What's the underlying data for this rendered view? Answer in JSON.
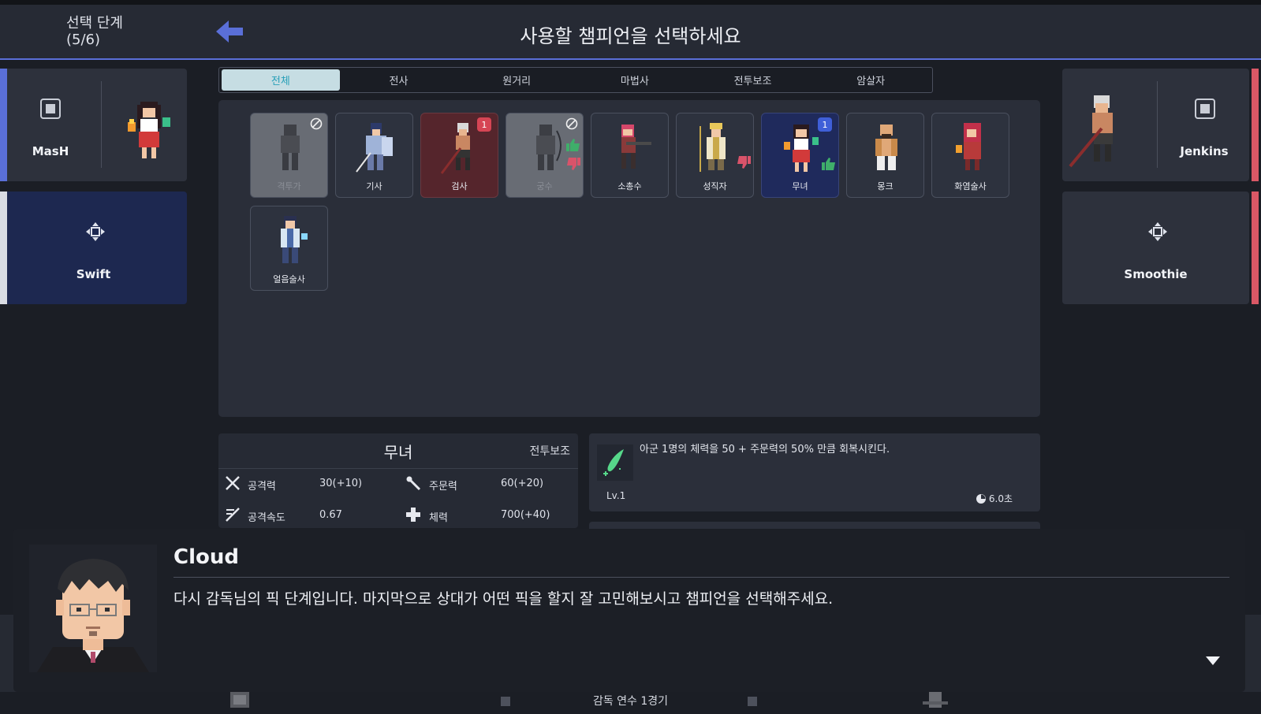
{
  "header": {
    "phase_label": "선택 단계",
    "phase_progress": "(5/6)",
    "title": "사용할 챔피언을 선택하세요"
  },
  "left_team": [
    {
      "player": "MasH",
      "champion_icon": "shrine-maiden-sprite",
      "status": "picked",
      "bar_color": "#5a6fd8"
    },
    {
      "player": "Swift",
      "status": "picking",
      "bar_color": "#d9dce3"
    }
  ],
  "right_team": [
    {
      "player": "Jenkins",
      "champion_icon": "swordsman-sprite",
      "status": "picked",
      "bar_color": "#d95866"
    },
    {
      "player": "Smoothie",
      "status": "waiting",
      "bar_color": "#d95866"
    }
  ],
  "tabs": [
    {
      "label": "전체",
      "active": true
    },
    {
      "label": "전사",
      "active": false
    },
    {
      "label": "원거리",
      "active": false
    },
    {
      "label": "마법사",
      "active": false
    },
    {
      "label": "전투보조",
      "active": false
    },
    {
      "label": "암살자",
      "active": false
    }
  ],
  "champions": [
    {
      "name": "격투가",
      "state": "banned"
    },
    {
      "name": "기사",
      "state": "available"
    },
    {
      "name": "검사",
      "state": "enemy-picked",
      "badge": "1"
    },
    {
      "name": "궁수",
      "state": "banned",
      "votes": "up-down"
    },
    {
      "name": "소총수",
      "state": "available"
    },
    {
      "name": "성직자",
      "state": "available",
      "votes": "down"
    },
    {
      "name": "무녀",
      "state": "ally-selected",
      "badge": "1",
      "votes": "up"
    },
    {
      "name": "몽크",
      "state": "available"
    },
    {
      "name": "화염술사",
      "state": "available"
    },
    {
      "name": "얼음술사",
      "state": "available"
    }
  ],
  "info": {
    "name": "무녀",
    "class": "전투보조",
    "stats": [
      {
        "label": "공격력",
        "value": "30(+10)",
        "icon": "swords-icon"
      },
      {
        "label": "주문력",
        "value": "60(+20)",
        "icon": "wand-icon"
      },
      {
        "label": "공격속도",
        "value": "0.67",
        "icon": "attack-speed-icon"
      },
      {
        "label": "체력",
        "value": "700(+40)",
        "icon": "health-cross-icon"
      }
    ]
  },
  "skill": {
    "description": "아군 1명의 체력을 50 + 주문력의 50% 만큼 회복시킨다.",
    "level": "Lv.1",
    "cooldown": "6.0초"
  },
  "dialog": {
    "speaker": "Cloud",
    "text": "다시 감독님의 픽 단계입니다. 마지막으로 상대가 어떤 픽을 할지 잘 고민해보시고 챔피언을 선택해주세요."
  },
  "footer": {
    "text": "감독 연수 1경기"
  },
  "colors": {
    "accent": "#5a6fd8",
    "enemy": "#d95866",
    "tab_active": "#c6dde3"
  }
}
